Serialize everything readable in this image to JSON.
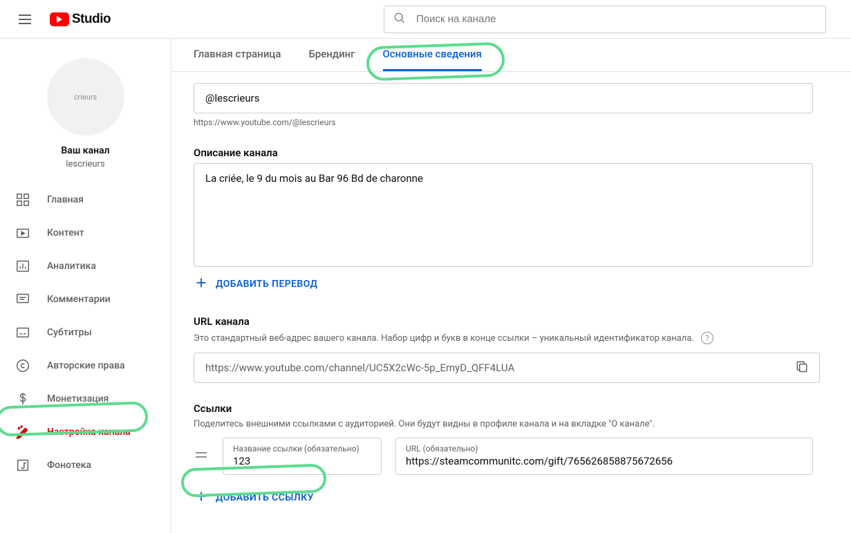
{
  "header": {
    "logo_text": "Studio",
    "search_placeholder": "Поиск на канале"
  },
  "sidebar": {
    "channel_avatar_text": "crieurs",
    "channel_title": "Ваш канал",
    "channel_name": "lescrieurs",
    "items": [
      {
        "icon": "dashboard",
        "label": "Главная"
      },
      {
        "icon": "content",
        "label": "Контент"
      },
      {
        "icon": "analytics",
        "label": "Аналитика"
      },
      {
        "icon": "comments",
        "label": "Комментарии"
      },
      {
        "icon": "subtitles",
        "label": "Субтитры"
      },
      {
        "icon": "copyright",
        "label": "Авторские права"
      },
      {
        "icon": "monetize",
        "label": "Монетизация"
      },
      {
        "icon": "customize",
        "label": "Настройка канала"
      },
      {
        "icon": "audio",
        "label": "Фонотека"
      }
    ]
  },
  "tabs": [
    {
      "label": "Главная страница"
    },
    {
      "label": "Брендинг"
    },
    {
      "label": "Основные сведения"
    }
  ],
  "handle": {
    "value": "@lescrieurs",
    "url_helper": "https://www.youtube.com/@lescrieurs"
  },
  "description": {
    "title": "Описание канала",
    "value": "La criée, le 9 du mois au Bar 96 Bd de charonne",
    "add_translation_btn": "ДОБАВИТЬ ПЕРЕВОД"
  },
  "channel_url": {
    "title": "URL канала",
    "desc": "Это стандартный веб-адрес вашего канала. Набор цифр и букв в конце ссылки – уникальный идентификатор канала.",
    "value": "https://www.youtube.com/channel/UC5X2cWc-5p_EmyD_QFF4LUA"
  },
  "links": {
    "title": "Ссылки",
    "desc": "Поделитесь внешними ссылками с аудиторией. Они будут видны в профиле канала и на вкладке \"О канале\".",
    "rows": [
      {
        "title_label": "Название ссылки (обязательно)",
        "title_value": "123",
        "url_label": "URL (обязательно)",
        "url_value": "https://steamcommunitc.com/gift/765626858875672656"
      }
    ],
    "add_link_btn": "ДОБАВИТЬ ССЫЛКУ"
  }
}
